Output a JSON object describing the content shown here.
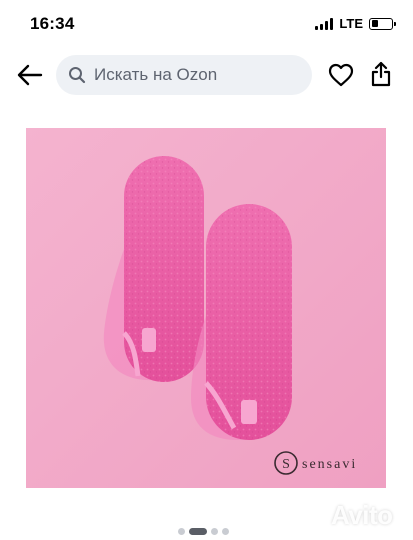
{
  "status_bar": {
    "time": "16:34",
    "network": "LTE",
    "battery_level": 0.35
  },
  "nav": {
    "back_icon": "arrow-left-icon",
    "search_placeholder": "Искать на Ozon",
    "favorite_icon": "heart-icon",
    "share_icon": "share-icon"
  },
  "product_image": {
    "brand_logo_text": "sensavi",
    "background_color": "#f2aac8",
    "slipper_color": "#ec5aa4"
  },
  "carousel": {
    "dot_count": 4,
    "active_index": 1
  },
  "watermark": {
    "text": "Avito"
  }
}
